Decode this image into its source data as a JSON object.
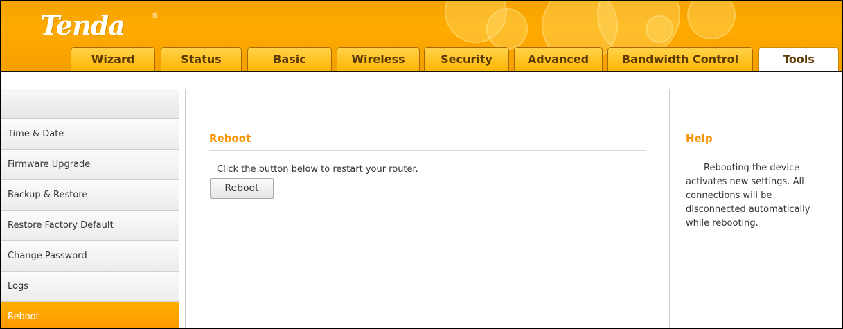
{
  "brand": {
    "logo": "Tenda",
    "registered": "®"
  },
  "nav": {
    "tabs": [
      {
        "label": "Wizard"
      },
      {
        "label": "Status"
      },
      {
        "label": "Basic"
      },
      {
        "label": "Wireless"
      },
      {
        "label": "Security"
      },
      {
        "label": "Advanced"
      },
      {
        "label": "Bandwidth Control"
      },
      {
        "label": "Tools",
        "active": true
      }
    ]
  },
  "sidebar": {
    "items": [
      {
        "label": "Time & Date"
      },
      {
        "label": "Firmware Upgrade"
      },
      {
        "label": "Backup & Restore"
      },
      {
        "label": "Restore Factory Default"
      },
      {
        "label": "Change Password"
      },
      {
        "label": "Logs"
      },
      {
        "label": "Reboot",
        "active": true
      }
    ]
  },
  "main": {
    "title": "Reboot",
    "description": "Click the button below to restart your router.",
    "button_label": "Reboot"
  },
  "help": {
    "title": "Help",
    "text": "Rebooting the device activates new settings. All connections will be disconnected automatically while rebooting."
  },
  "colors": {
    "accent": "#f59400",
    "header_orange": "#ffab00",
    "active_sidebar": "#ff9c00"
  }
}
